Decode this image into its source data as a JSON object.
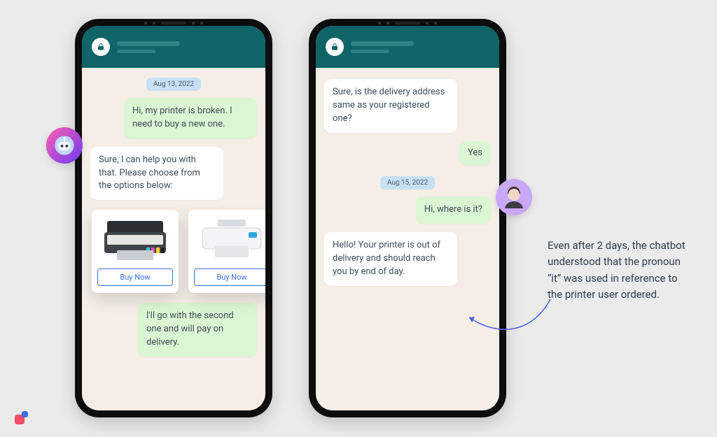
{
  "dates": {
    "left": "Aug 13, 2022",
    "right": "Aug 15, 2022"
  },
  "left_chat": {
    "msg_user_1": "Hi, my printer is broken. I need to buy a new one.",
    "msg_bot_1": "Sure, I can help you with that. Please choose from the options below:",
    "msg_user_2": "I'll go with the second one and will pay on delivery."
  },
  "right_chat": {
    "msg_bot_1": "Sure, is the delivery address same as your registered one?",
    "msg_user_1": "Yes",
    "msg_user_2": "Hi, where is it?",
    "msg_bot_2": "Hello! Your printer is out of delivery and should reach you by end of day."
  },
  "products": {
    "option_1": {
      "buy_label": "Buy Now"
    },
    "option_2": {
      "buy_label": "Buy Now"
    }
  },
  "annotation": "Even after 2 days, the chatbot understood that the pronoun “it” was used in reference to the printer user ordered.",
  "icons": {
    "contact": "lock-icon",
    "bot_avatar": "chatbot-avatar",
    "human_avatar": "human-avatar"
  },
  "colors": {
    "header": "#0E6466",
    "chat_bg": "#F4EEE7",
    "user_bubble": "#DBF6D3",
    "date_chip": "#C8E0F4",
    "cta_blue": "#3B6FE3"
  }
}
